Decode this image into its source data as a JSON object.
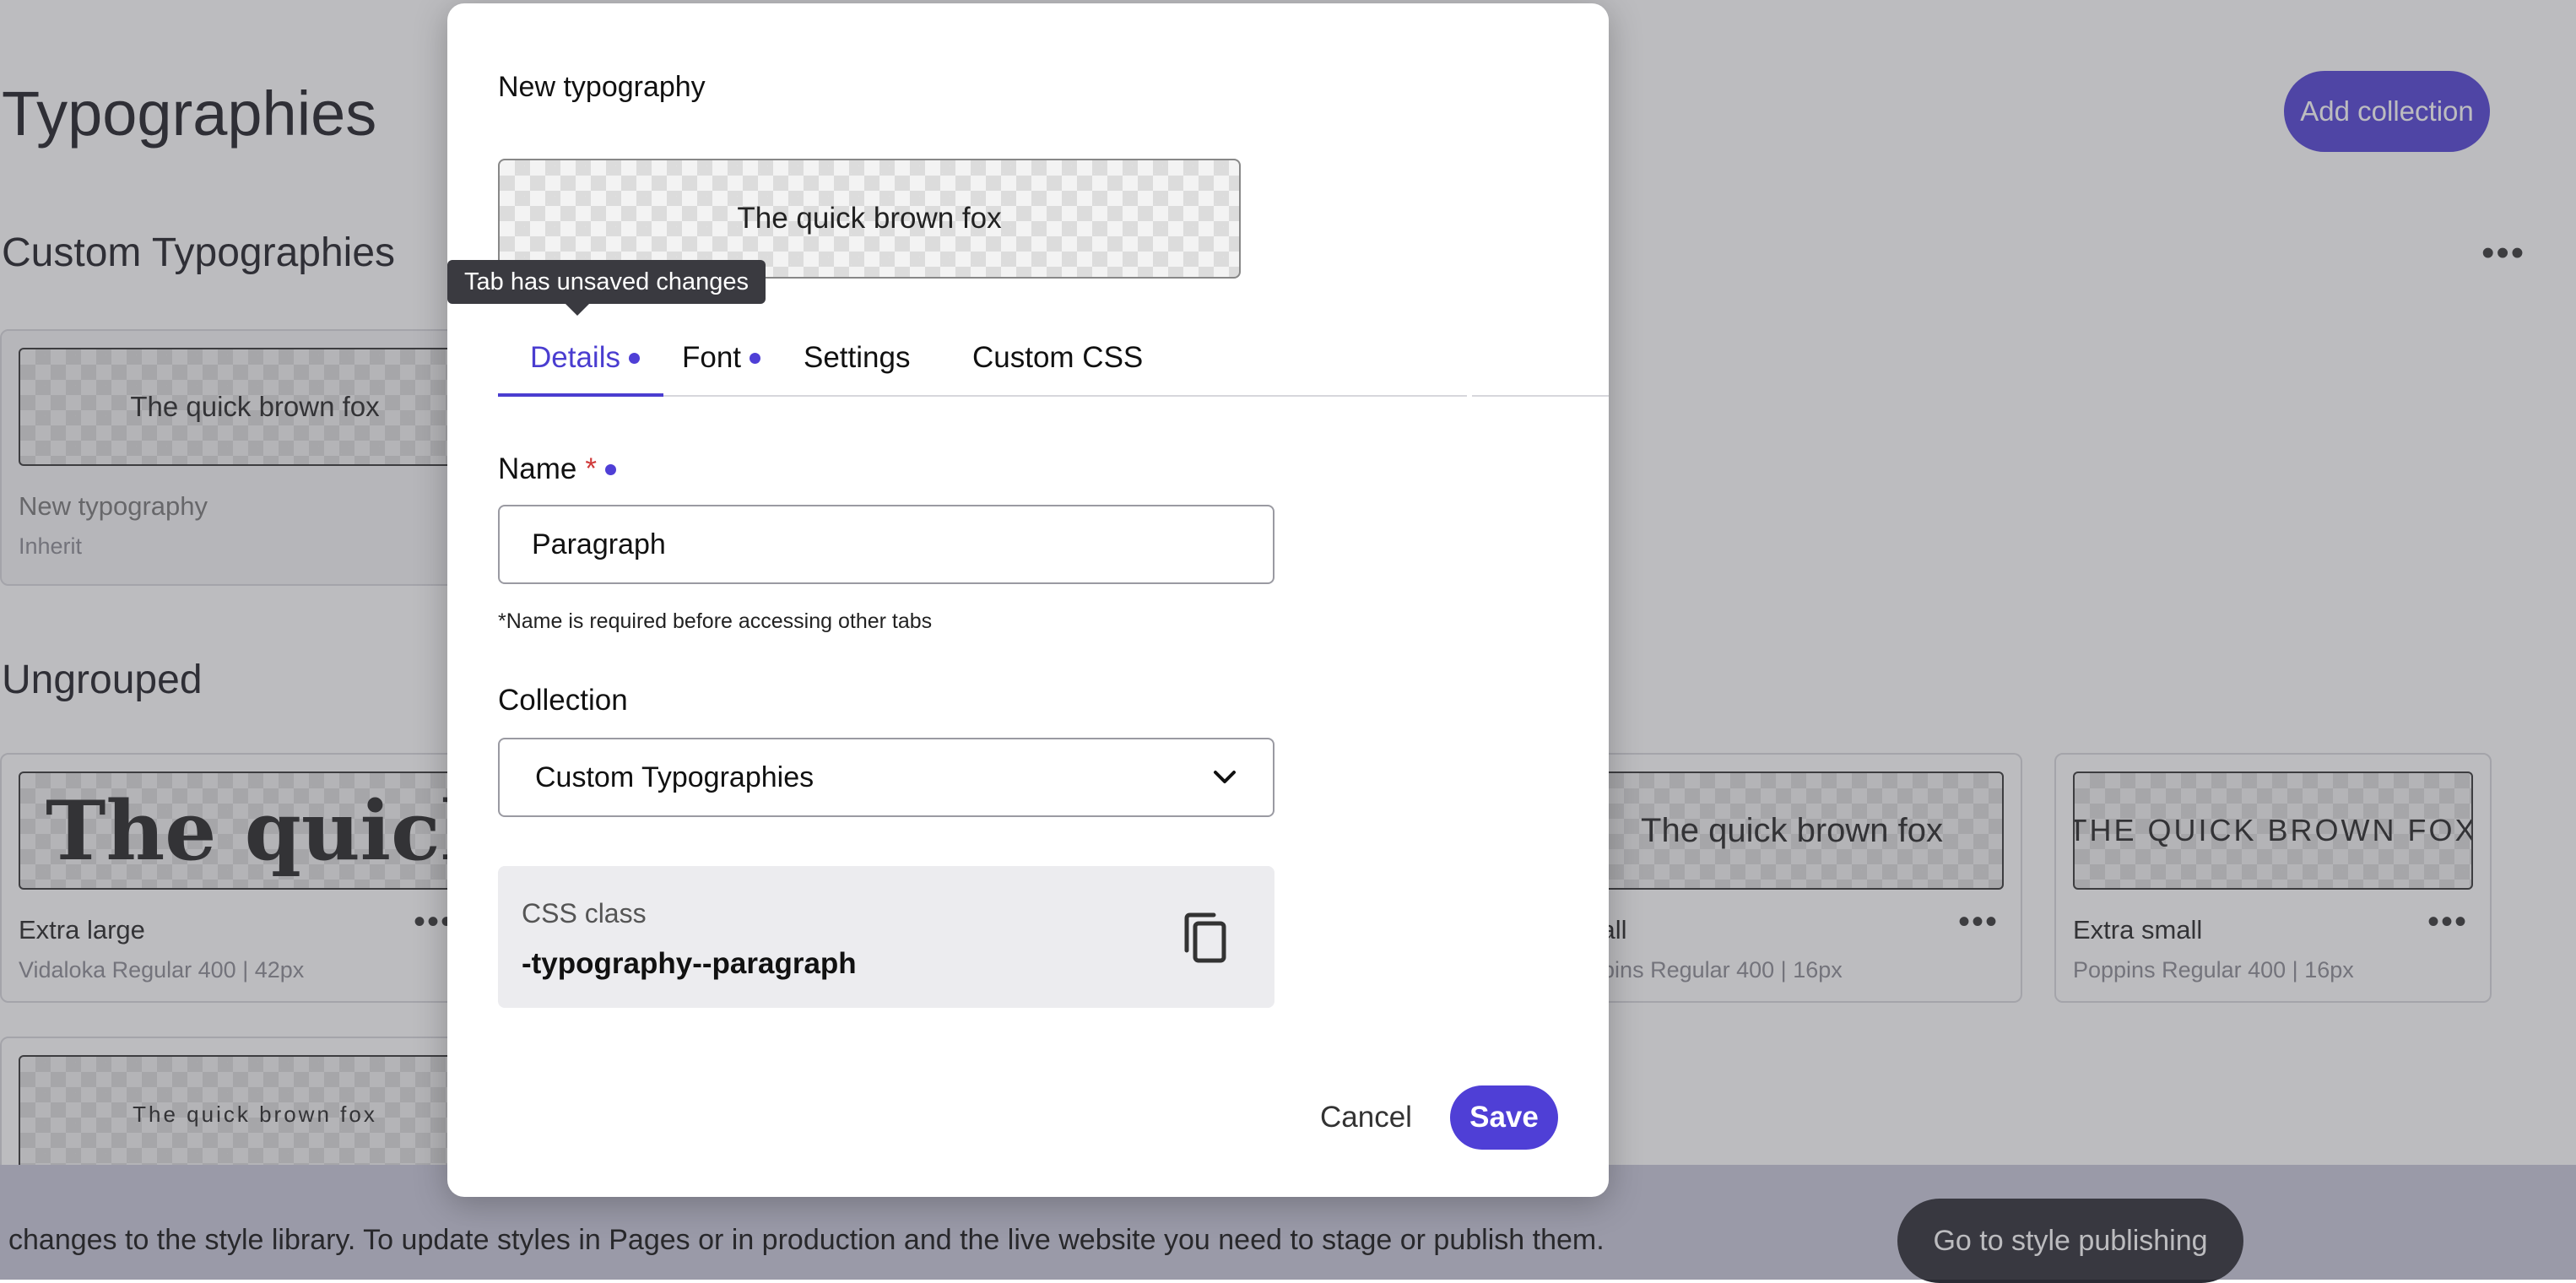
{
  "page": {
    "title": "Typographies",
    "add_collection_label": "Add collection",
    "more_icon": "…"
  },
  "custom_section": {
    "title": "Custom Typographies",
    "card": {
      "preview_text": "The quick brown fox",
      "name": "New typography",
      "meta": "Inherit"
    }
  },
  "ungrouped_section": {
    "title": "Ungrouped",
    "cards": [
      {
        "preview_text": "The quick brown fox",
        "name": "Extra large",
        "meta": "Vidaloka Regular 400 | 42px"
      },
      {
        "preview_text": "The quick brown fox",
        "name": "Small",
        "meta": "Poppins Regular 400 | 16px"
      },
      {
        "preview_text": "THE QUICK BROWN FOX",
        "name": "Extra small",
        "meta": "Poppins Regular 400 | 16px"
      },
      {
        "preview_text": "The quick brown fox"
      }
    ]
  },
  "banner": {
    "text": "changes to the style library. To update styles in Pages or in production and the live website you need to stage or publish them.",
    "button_label": "Go to style publishing"
  },
  "modal": {
    "title": "New typography",
    "preview_text": "The quick brown fox",
    "tooltip": "Tab has unsaved changes",
    "tabs": [
      {
        "label": "Details",
        "unsaved": true,
        "active": true
      },
      {
        "label": "Font",
        "unsaved": true,
        "active": false
      },
      {
        "label": "Settings",
        "unsaved": false,
        "active": false
      },
      {
        "label": "Custom CSS",
        "unsaved": false,
        "active": false
      }
    ],
    "name_field": {
      "label": "Name",
      "required_marker": "*",
      "value": "Paragraph",
      "hint": "*Name is required before accessing other tabs"
    },
    "collection_field": {
      "label": "Collection",
      "selected": "Custom Typographies"
    },
    "css_class": {
      "label": "CSS class",
      "value": "-typography--paragraph"
    },
    "cancel_label": "Cancel",
    "save_label": "Save"
  },
  "colors": {
    "accent": "#4f3fd6",
    "required": "#d03a3a",
    "tooltip_bg": "#3a3a40"
  }
}
